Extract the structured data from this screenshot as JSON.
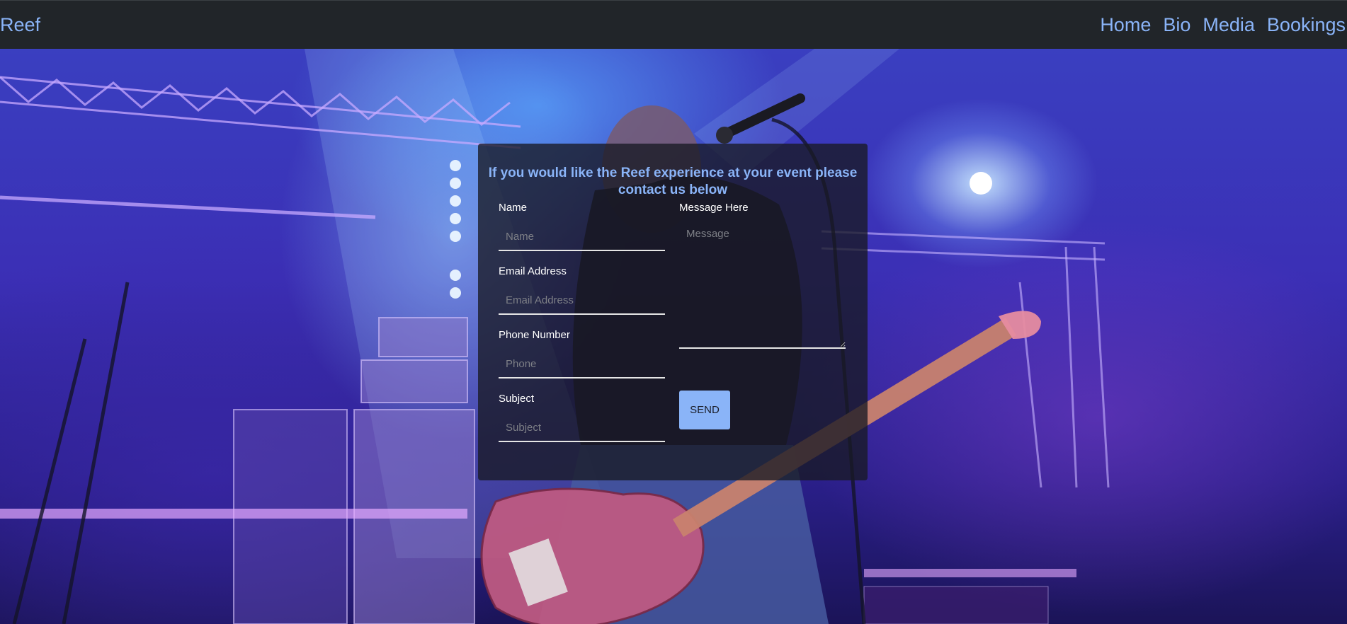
{
  "nav": {
    "brand": "Reef",
    "links": [
      {
        "label": "Home"
      },
      {
        "label": "Bio"
      },
      {
        "label": "Media"
      },
      {
        "label": "Bookings"
      }
    ],
    "accent_color": "#8ab4f8",
    "background_color": "#212529"
  },
  "form": {
    "title": "If you would like the Reef experience at your event please contact us below",
    "name": {
      "label": "Name",
      "placeholder": "Name",
      "value": ""
    },
    "email": {
      "label": "Email Address",
      "placeholder": "Email Address",
      "value": ""
    },
    "phone": {
      "label": "Phone Number",
      "placeholder": "Phone",
      "value": ""
    },
    "subject": {
      "label": "Subject",
      "placeholder": "Subject",
      "value": ""
    },
    "message": {
      "label": "Message Here",
      "placeholder": "Message",
      "value": ""
    },
    "send_label": "SEND"
  }
}
